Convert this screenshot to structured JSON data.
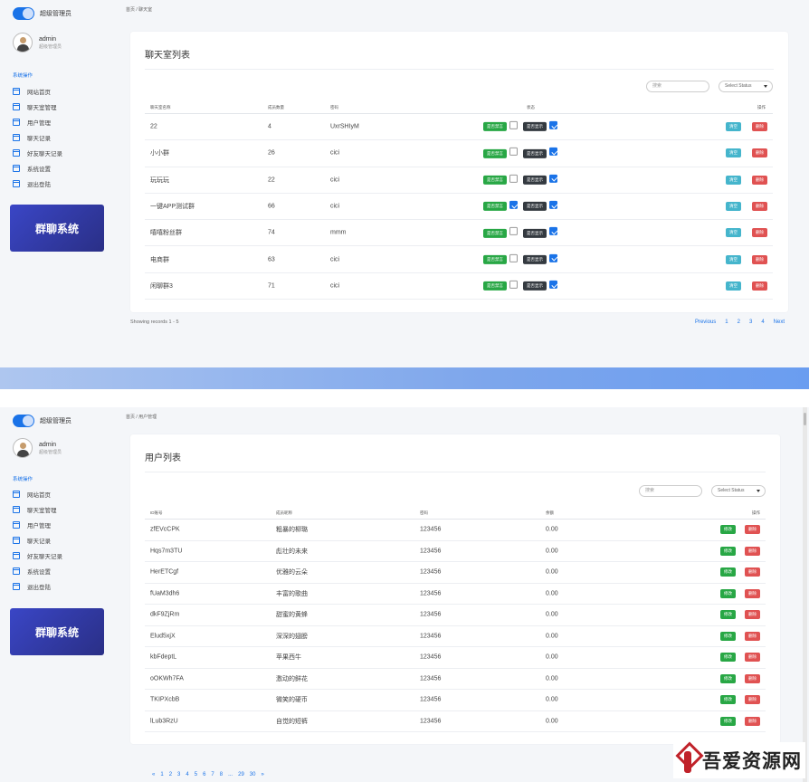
{
  "app": {
    "logo_text": "超级管理员",
    "user_name": "admin",
    "user_role": "超级管理员",
    "menu_section": "系统操作",
    "menu": [
      "网站首页",
      "聊天室管理",
      "用户管理",
      "聊天记录",
      "好友聊天记录",
      "系统设置",
      "退出登陆"
    ],
    "brand": "群聊系统"
  },
  "screen1": {
    "breadcrumb": "首页 / 聊天室",
    "title": "聊天室列表",
    "search_placeholder": "搜索",
    "status_select": "Select Status",
    "headers": [
      "聊天室名称",
      "成员数量",
      "密码",
      "状态",
      "操作"
    ],
    "mute_label": "是否禁言",
    "show_label": "是否显示",
    "clear_label": "清空",
    "delete_label": "删除",
    "rows": [
      {
        "name": "22",
        "members": "4",
        "password": "UxrSHIyM",
        "mute": false,
        "show": true
      },
      {
        "name": "小小群",
        "members": "26",
        "password": "cici",
        "mute": false,
        "show": true
      },
      {
        "name": "玩玩玩",
        "members": "22",
        "password": "cici",
        "mute": false,
        "show": true
      },
      {
        "name": "一键APP测试群",
        "members": "66",
        "password": "cici",
        "mute": true,
        "show": true
      },
      {
        "name": "嘻嘻粉丝群",
        "members": "74",
        "password": "mmm",
        "mute": false,
        "show": true
      },
      {
        "name": "电商群",
        "members": "63",
        "password": "cici",
        "mute": false,
        "show": true
      },
      {
        "name": "闲聊群3",
        "members": "71",
        "password": "cici",
        "mute": false,
        "show": true
      }
    ],
    "records": "Showing records 1 - 5",
    "pager": [
      "Previous",
      "1",
      "2",
      "3",
      "4",
      "Next"
    ]
  },
  "screen2": {
    "breadcrumb": "首页 / 用户管理",
    "title": "用户列表",
    "search_placeholder": "搜索",
    "status_select": "Select Status",
    "headers": [
      "ID账号",
      "成员昵称",
      "密码",
      "余额",
      "操作"
    ],
    "edit_label": "修改",
    "delete_label": "删除",
    "rows": [
      {
        "id": "zfEVcCPK",
        "nick": "粗暴的柳璐",
        "password": "123456",
        "balance": "0.00"
      },
      {
        "id": "Hqs7m3TU",
        "nick": "彪壮的未来",
        "password": "123456",
        "balance": "0.00"
      },
      {
        "id": "HerETCgf",
        "nick": "优雅的云朵",
        "password": "123456",
        "balance": "0.00"
      },
      {
        "id": "fUaM3dh6",
        "nick": "丰富的歌曲",
        "password": "123456",
        "balance": "0.00"
      },
      {
        "id": "dkF9ZjRm",
        "nick": "甜蜜的黄蜂",
        "password": "123456",
        "balance": "0.00"
      },
      {
        "id": "Elud5xjX",
        "nick": "深深的翅膀",
        "password": "123456",
        "balance": "0.00"
      },
      {
        "id": "kbFdeptL",
        "nick": "苹果西牛",
        "password": "123456",
        "balance": "0.00"
      },
      {
        "id": "oOKWh7FA",
        "nick": "激动的鲜花",
        "password": "123456",
        "balance": "0.00"
      },
      {
        "id": "TKIPXcbB",
        "nick": "微笑的硬币",
        "password": "123456",
        "balance": "0.00"
      },
      {
        "id": "lLub3RzU",
        "nick": "自觉的短裤",
        "password": "123456",
        "balance": "0.00"
      }
    ],
    "pager": [
      "«",
      "1",
      "2",
      "3",
      "4",
      "5",
      "6",
      "7",
      "8",
      "...",
      "29",
      "30",
      "»"
    ]
  },
  "watermark": "吾爱资源网"
}
